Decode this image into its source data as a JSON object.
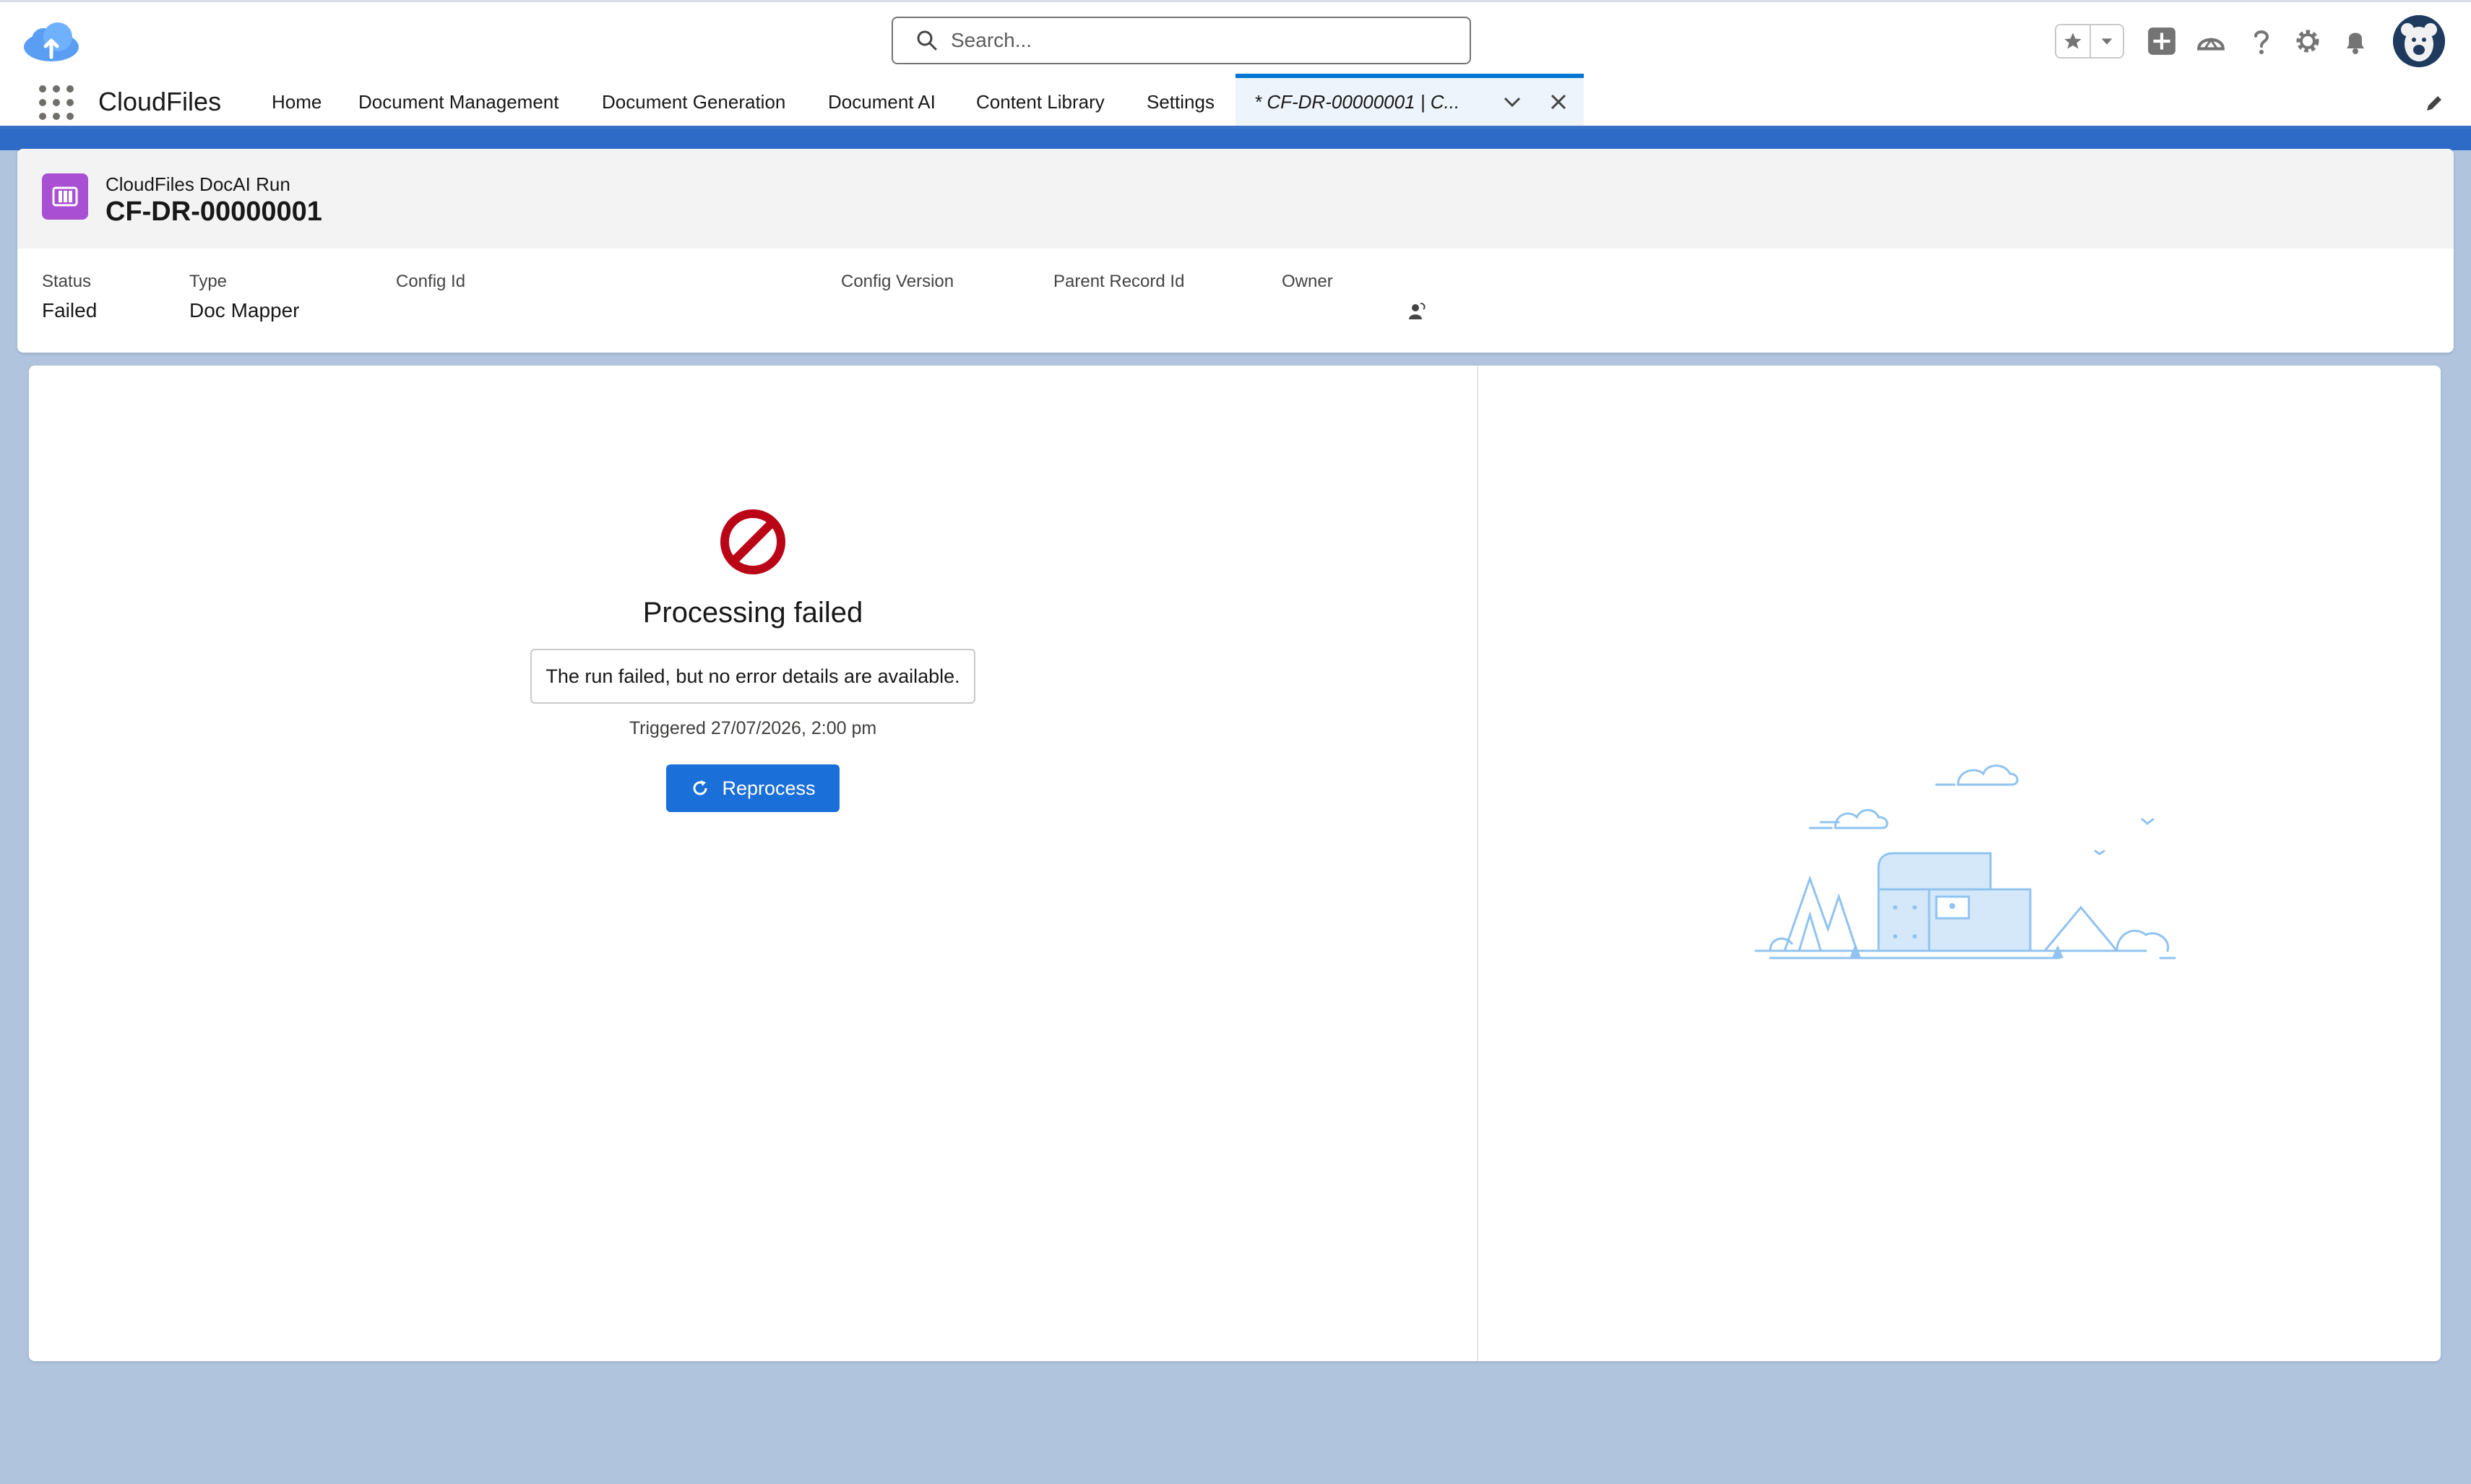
{
  "app": {
    "name": "CloudFiles"
  },
  "search": {
    "placeholder": "Search..."
  },
  "nav": {
    "items": [
      {
        "label": "Home"
      },
      {
        "label": "Document Management"
      },
      {
        "label": "Document Generation"
      },
      {
        "label": "Document AI"
      },
      {
        "label": "Content Library"
      },
      {
        "label": "Settings"
      }
    ],
    "active_tab": {
      "label": "* CF-DR-00000001 | C..."
    }
  },
  "record": {
    "type_label": "CloudFiles DocAI Run",
    "title": "CF-DR-00000001",
    "fields": [
      {
        "label": "Status",
        "value": "Failed"
      },
      {
        "label": "Type",
        "value": "Doc Mapper"
      },
      {
        "label": "Config Id",
        "value": ""
      },
      {
        "label": "Config Version",
        "value": ""
      },
      {
        "label": "Parent Record Id",
        "value": ""
      },
      {
        "label": "Owner",
        "value": ""
      }
    ]
  },
  "result": {
    "title": "Processing failed",
    "message": "The run failed, but no error details are available.",
    "triggered": "Triggered 27/07/2026, 2:00 pm",
    "reprocess_label": "Reprocess"
  },
  "colors": {
    "brand": "#0176d3",
    "button": "#1b6fd8",
    "error": "#ba0517",
    "background": "#b0c4de",
    "record_icon": "#a94fd4"
  },
  "icons": {
    "logo": "cloud-upload-icon",
    "search": "search-icon",
    "favorites": "star-icon",
    "add": "plus-icon",
    "trailhead": "trailhead-icon",
    "help": "question-icon",
    "setup": "gear-icon",
    "notifications": "bell-icon",
    "avatar": "bear-avatar-icon",
    "fail": "no-entry-icon",
    "reprocess": "refresh-icon"
  }
}
